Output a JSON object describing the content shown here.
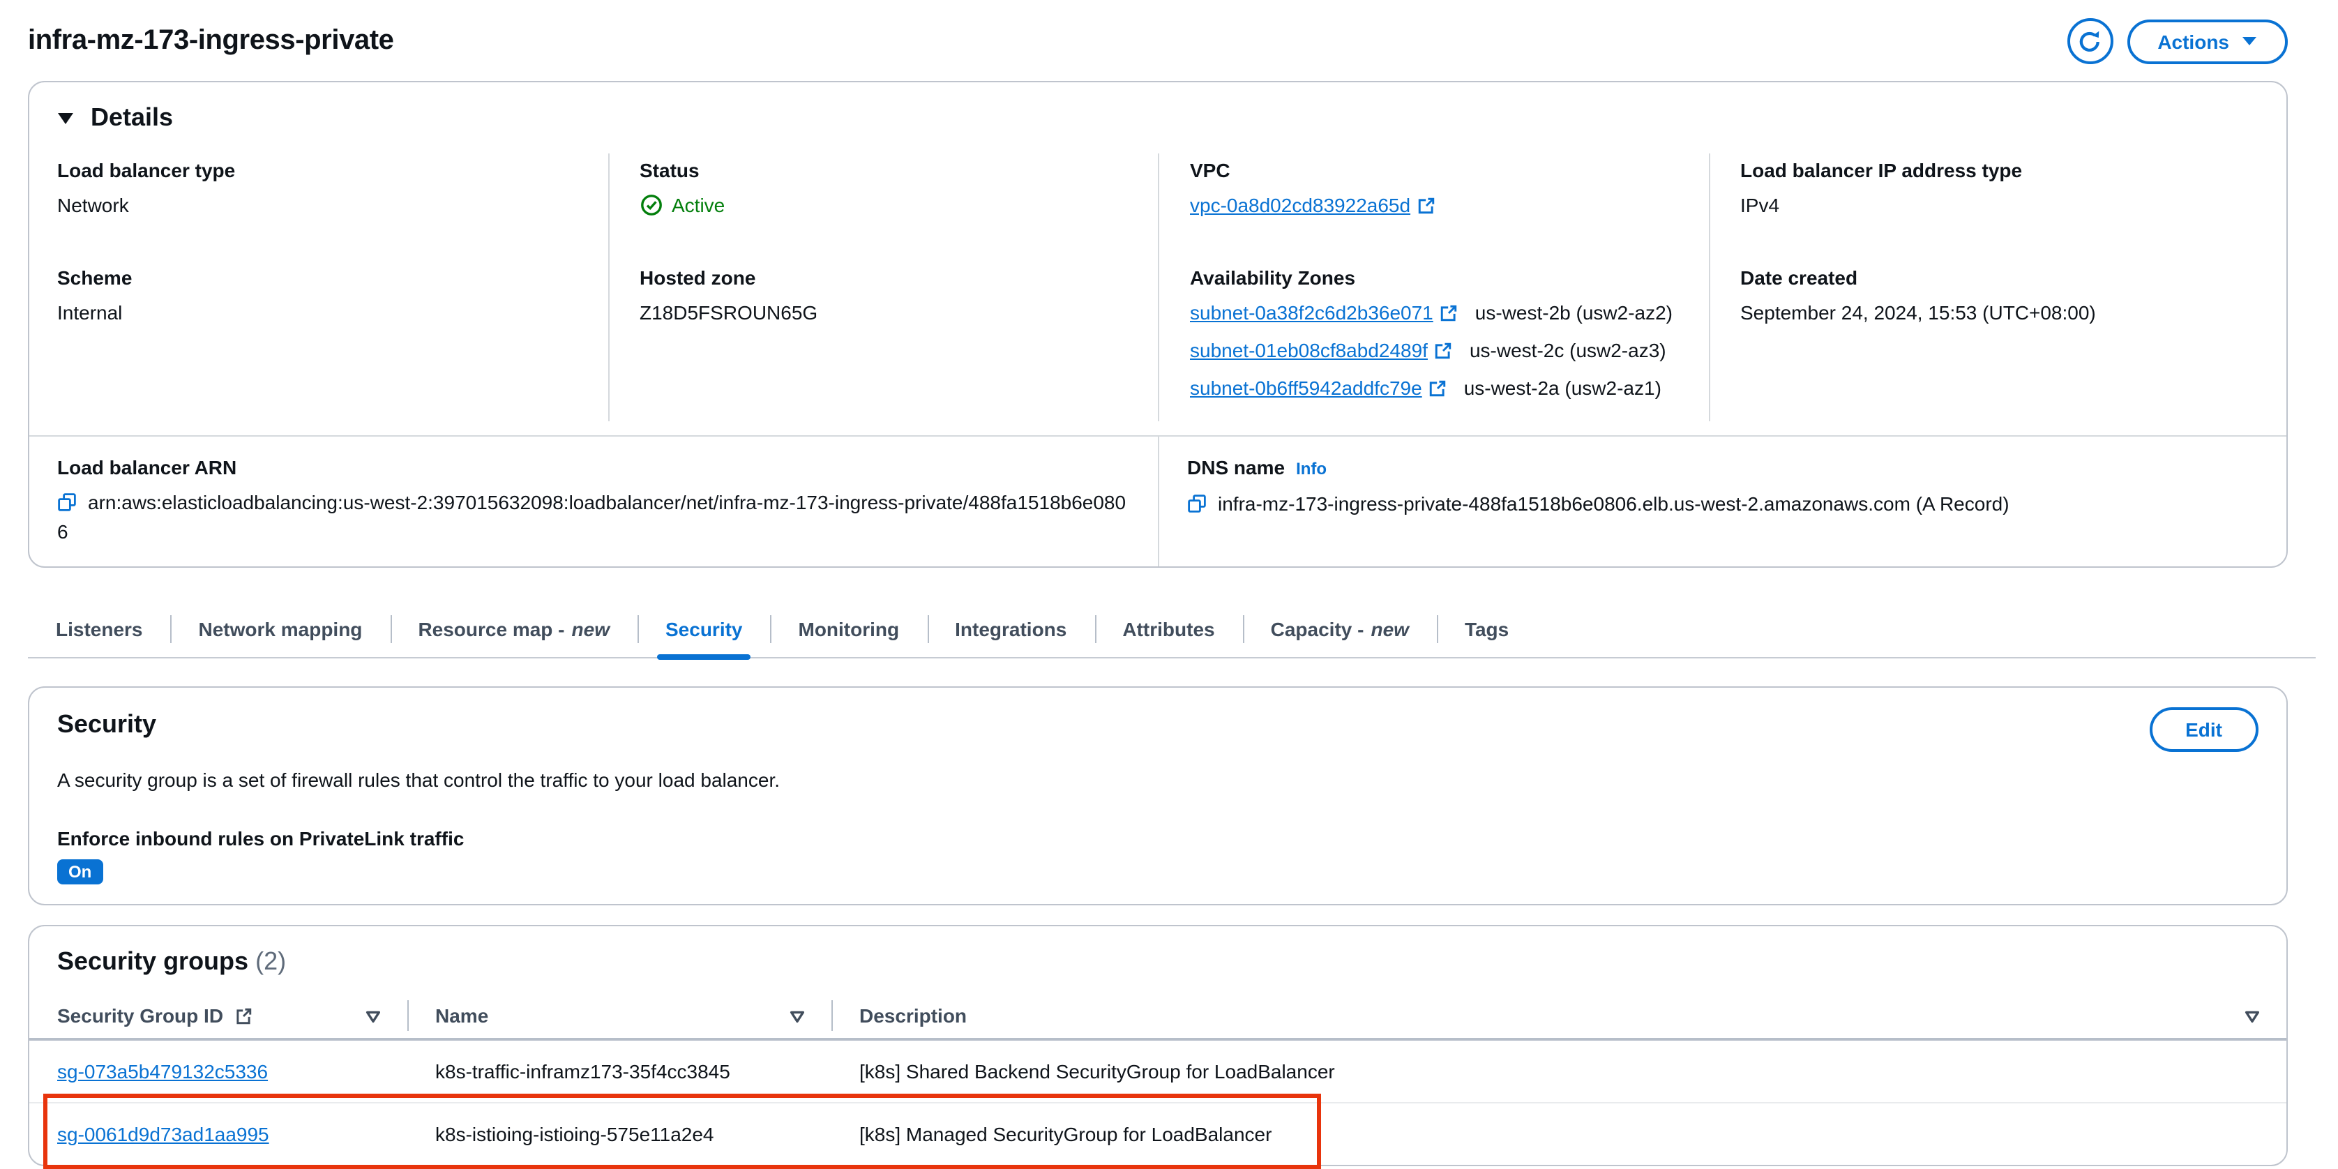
{
  "page": {
    "title": "infra-mz-173-ingress-private",
    "actions_label": "Actions"
  },
  "details": {
    "heading": "Details",
    "lb_type_label": "Load balancer type",
    "lb_type_value": "Network",
    "scheme_label": "Scheme",
    "scheme_value": "Internal",
    "status_label": "Status",
    "status_value": "Active",
    "hosted_zone_label": "Hosted zone",
    "hosted_zone_value": "Z18D5FSROUN65G",
    "vpc_label": "VPC",
    "vpc_value": "vpc-0a8d02cd83922a65d",
    "az_label": "Availability Zones",
    "azs": [
      {
        "subnet": "subnet-0a38f2c6d2b36e071",
        "zone": "us-west-2b (usw2-az2)"
      },
      {
        "subnet": "subnet-01eb08cf8abd2489f",
        "zone": "us-west-2c (usw2-az3)"
      },
      {
        "subnet": "subnet-0b6ff5942addfc79e",
        "zone": "us-west-2a (usw2-az1)"
      }
    ],
    "ip_type_label": "Load balancer IP address type",
    "ip_type_value": "IPv4",
    "date_created_label": "Date created",
    "date_created_value": "September 24, 2024, 15:53 (UTC+08:00)",
    "arn_label": "Load balancer ARN",
    "arn_value": "arn:aws:elasticloadbalancing:us-west-2:397015632098:loadbalancer/net/infra-mz-173-ingress-private/488fa1518b6e0806",
    "dns_label": "DNS name",
    "dns_info": "Info",
    "dns_value": "infra-mz-173-ingress-private-488fa1518b6e0806.elb.us-west-2.amazonaws.com (A Record)"
  },
  "tabs": [
    {
      "label": "Listeners"
    },
    {
      "label": "Network mapping"
    },
    {
      "label": "Resource map -",
      "suffix": "new"
    },
    {
      "label": "Security",
      "active": true
    },
    {
      "label": "Monitoring"
    },
    {
      "label": "Integrations"
    },
    {
      "label": "Attributes"
    },
    {
      "label": "Capacity -",
      "suffix": "new"
    },
    {
      "label": "Tags"
    }
  ],
  "security": {
    "heading": "Security",
    "edit_label": "Edit",
    "description": "A security group is a set of firewall rules that control the traffic to your load balancer.",
    "privatelink_label": "Enforce inbound rules on PrivateLink traffic",
    "privatelink_value": "On"
  },
  "security_groups": {
    "heading": "Security groups",
    "count": "(2)",
    "columns": [
      {
        "label": "Security Group ID"
      },
      {
        "label": "Name"
      },
      {
        "label": "Description"
      }
    ],
    "rows": [
      {
        "id": "sg-073a5b479132c5336",
        "name": "k8s-traffic-inframz173-35f4cc3845",
        "description": "[k8s] Shared Backend SecurityGroup for LoadBalancer",
        "highlighted": false
      },
      {
        "id": "sg-0061d9d73ad1aa995",
        "name": "k8s-istioing-istioing-575e11a2e4",
        "description": "[k8s] Managed SecurityGroup for LoadBalancer",
        "highlighted": true
      }
    ]
  },
  "colors": {
    "accent_blue": "#0972d3",
    "status_green": "#037f0c",
    "highlight_red": "#e8340c",
    "header_text": "#414d5c",
    "text": "#0f141a"
  }
}
